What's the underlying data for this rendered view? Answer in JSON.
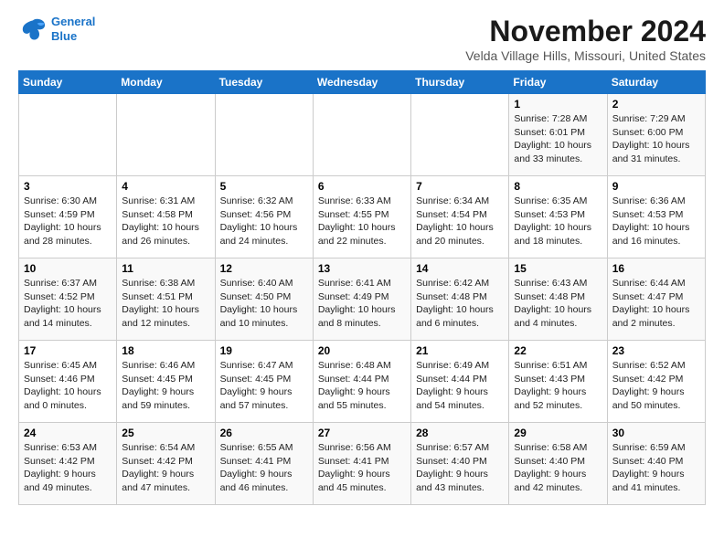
{
  "logo": {
    "line1": "General",
    "line2": "Blue"
  },
  "title": "November 2024",
  "location": "Velda Village Hills, Missouri, United States",
  "weekdays": [
    "Sunday",
    "Monday",
    "Tuesday",
    "Wednesday",
    "Thursday",
    "Friday",
    "Saturday"
  ],
  "weeks": [
    [
      {
        "day": "",
        "content": ""
      },
      {
        "day": "",
        "content": ""
      },
      {
        "day": "",
        "content": ""
      },
      {
        "day": "",
        "content": ""
      },
      {
        "day": "",
        "content": ""
      },
      {
        "day": "1",
        "content": "Sunrise: 7:28 AM\nSunset: 6:01 PM\nDaylight: 10 hours\nand 33 minutes."
      },
      {
        "day": "2",
        "content": "Sunrise: 7:29 AM\nSunset: 6:00 PM\nDaylight: 10 hours\nand 31 minutes."
      }
    ],
    [
      {
        "day": "3",
        "content": "Sunrise: 6:30 AM\nSunset: 4:59 PM\nDaylight: 10 hours\nand 28 minutes."
      },
      {
        "day": "4",
        "content": "Sunrise: 6:31 AM\nSunset: 4:58 PM\nDaylight: 10 hours\nand 26 minutes."
      },
      {
        "day": "5",
        "content": "Sunrise: 6:32 AM\nSunset: 4:56 PM\nDaylight: 10 hours\nand 24 minutes."
      },
      {
        "day": "6",
        "content": "Sunrise: 6:33 AM\nSunset: 4:55 PM\nDaylight: 10 hours\nand 22 minutes."
      },
      {
        "day": "7",
        "content": "Sunrise: 6:34 AM\nSunset: 4:54 PM\nDaylight: 10 hours\nand 20 minutes."
      },
      {
        "day": "8",
        "content": "Sunrise: 6:35 AM\nSunset: 4:53 PM\nDaylight: 10 hours\nand 18 minutes."
      },
      {
        "day": "9",
        "content": "Sunrise: 6:36 AM\nSunset: 4:53 PM\nDaylight: 10 hours\nand 16 minutes."
      }
    ],
    [
      {
        "day": "10",
        "content": "Sunrise: 6:37 AM\nSunset: 4:52 PM\nDaylight: 10 hours\nand 14 minutes."
      },
      {
        "day": "11",
        "content": "Sunrise: 6:38 AM\nSunset: 4:51 PM\nDaylight: 10 hours\nand 12 minutes."
      },
      {
        "day": "12",
        "content": "Sunrise: 6:40 AM\nSunset: 4:50 PM\nDaylight: 10 hours\nand 10 minutes."
      },
      {
        "day": "13",
        "content": "Sunrise: 6:41 AM\nSunset: 4:49 PM\nDaylight: 10 hours\nand 8 minutes."
      },
      {
        "day": "14",
        "content": "Sunrise: 6:42 AM\nSunset: 4:48 PM\nDaylight: 10 hours\nand 6 minutes."
      },
      {
        "day": "15",
        "content": "Sunrise: 6:43 AM\nSunset: 4:48 PM\nDaylight: 10 hours\nand 4 minutes."
      },
      {
        "day": "16",
        "content": "Sunrise: 6:44 AM\nSunset: 4:47 PM\nDaylight: 10 hours\nand 2 minutes."
      }
    ],
    [
      {
        "day": "17",
        "content": "Sunrise: 6:45 AM\nSunset: 4:46 PM\nDaylight: 10 hours\nand 0 minutes."
      },
      {
        "day": "18",
        "content": "Sunrise: 6:46 AM\nSunset: 4:45 PM\nDaylight: 9 hours\nand 59 minutes."
      },
      {
        "day": "19",
        "content": "Sunrise: 6:47 AM\nSunset: 4:45 PM\nDaylight: 9 hours\nand 57 minutes."
      },
      {
        "day": "20",
        "content": "Sunrise: 6:48 AM\nSunset: 4:44 PM\nDaylight: 9 hours\nand 55 minutes."
      },
      {
        "day": "21",
        "content": "Sunrise: 6:49 AM\nSunset: 4:44 PM\nDaylight: 9 hours\nand 54 minutes."
      },
      {
        "day": "22",
        "content": "Sunrise: 6:51 AM\nSunset: 4:43 PM\nDaylight: 9 hours\nand 52 minutes."
      },
      {
        "day": "23",
        "content": "Sunrise: 6:52 AM\nSunset: 4:42 PM\nDaylight: 9 hours\nand 50 minutes."
      }
    ],
    [
      {
        "day": "24",
        "content": "Sunrise: 6:53 AM\nSunset: 4:42 PM\nDaylight: 9 hours\nand 49 minutes."
      },
      {
        "day": "25",
        "content": "Sunrise: 6:54 AM\nSunset: 4:42 PM\nDaylight: 9 hours\nand 47 minutes."
      },
      {
        "day": "26",
        "content": "Sunrise: 6:55 AM\nSunset: 4:41 PM\nDaylight: 9 hours\nand 46 minutes."
      },
      {
        "day": "27",
        "content": "Sunrise: 6:56 AM\nSunset: 4:41 PM\nDaylight: 9 hours\nand 45 minutes."
      },
      {
        "day": "28",
        "content": "Sunrise: 6:57 AM\nSunset: 4:40 PM\nDaylight: 9 hours\nand 43 minutes."
      },
      {
        "day": "29",
        "content": "Sunrise: 6:58 AM\nSunset: 4:40 PM\nDaylight: 9 hours\nand 42 minutes."
      },
      {
        "day": "30",
        "content": "Sunrise: 6:59 AM\nSunset: 4:40 PM\nDaylight: 9 hours\nand 41 minutes."
      }
    ]
  ]
}
